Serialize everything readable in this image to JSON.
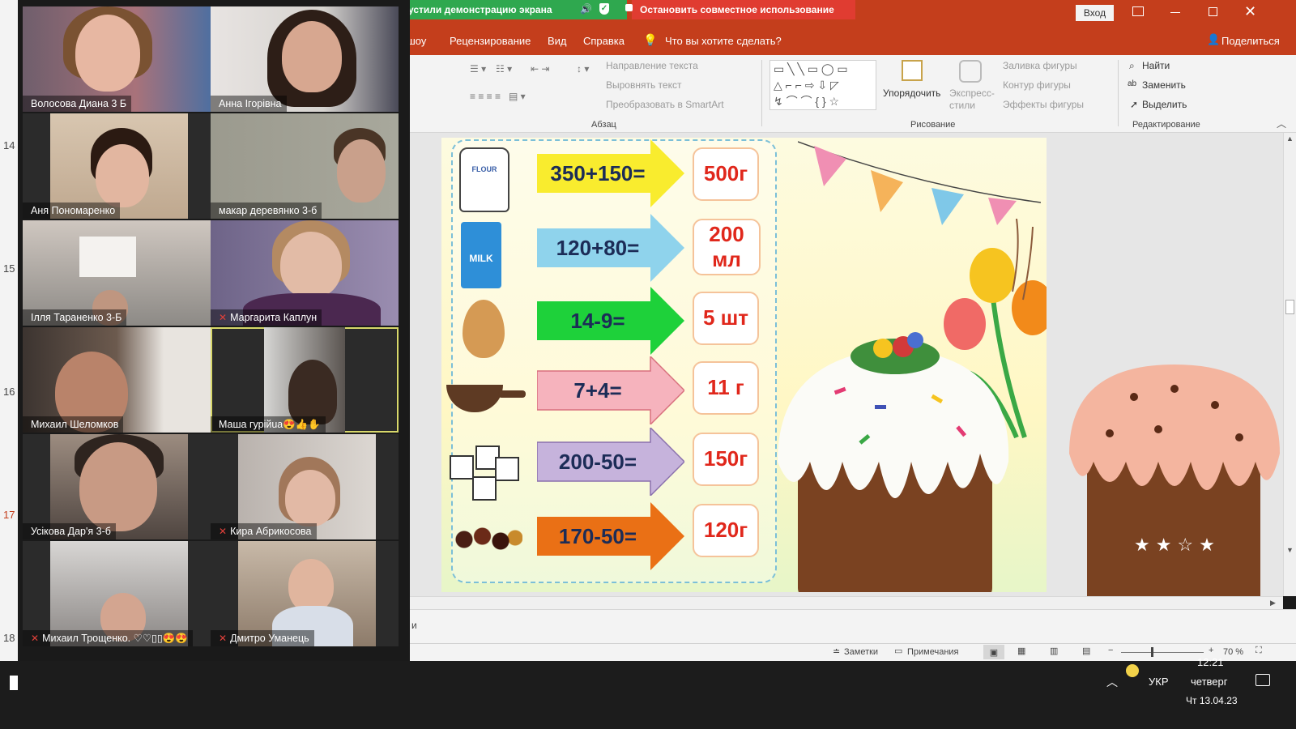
{
  "window": {
    "login_button": "Вход",
    "share_label": "Поделиться"
  },
  "ribbon_tabs": [
    "-шоу",
    "Рецензирование",
    "Вид",
    "Справка",
    "Что вы хотите сделать?"
  ],
  "ribbon": {
    "paragraph": {
      "label": "Абзац",
      "text_direction": "Направление текста",
      "align_text": "Выровнять текст",
      "smartart": "Преобразовать в SmartArt"
    },
    "drawing": {
      "label": "Рисование",
      "arrange": "Упорядочить",
      "quick_styles": "Экспресс-стили",
      "shape_fill": "Заливка фигуры",
      "shape_outline": "Контур фигуры",
      "shape_effects": "Эффекты фигуры"
    },
    "editing": {
      "label": "Редактирование",
      "find": "Найти",
      "replace": "Заменить",
      "select": "Выделить"
    }
  },
  "share_banner": {
    "status": "устили демонстрацию экрана",
    "stop": "Остановить совместное использование"
  },
  "slide": {
    "rows": [
      {
        "equation": "350+150=",
        "answer": "500г",
        "arrow_color": "#f9ec2e",
        "icon": "flour-bag-icon"
      },
      {
        "equation": "120+80=",
        "answer": "200 мл",
        "arrow_color": "#8fd3ec",
        "icon": "milk-carton-icon"
      },
      {
        "equation": "14-9=",
        "answer": "5 шт",
        "arrow_color": "#1ed13a",
        "icon": "egg-icon"
      },
      {
        "equation": "7+4=",
        "answer": "11 г",
        "arrow_color": "#f6b3bd",
        "icon": "scoop-icon"
      },
      {
        "equation": "200-50=",
        "answer": "150г",
        "arrow_color": "#c6b3dc",
        "icon": "sugar-cubes-icon"
      },
      {
        "equation": "170-50=",
        "answer": "120г",
        "arrow_color": "#ea7015",
        "icon": "raisins-icon"
      }
    ]
  },
  "slide_numbers": [
    "14",
    "15",
    "16",
    "17",
    "18"
  ],
  "notes_row": "и",
  "status": {
    "notes": "Заметки",
    "comments": "Примечания",
    "zoom": "70 %"
  },
  "participants": [
    {
      "name": "Волосова Диана 3 Б",
      "muted": false
    },
    {
      "name": "Анна Ігорівна",
      "muted": false
    },
    {
      "name": "Аня Пономаренко",
      "muted": false
    },
    {
      "name": "макар  деревянко 3-б",
      "muted": false
    },
    {
      "name": "Ілля Тараненко 3-Б",
      "muted": false
    },
    {
      "name": "Маргарита Каплун",
      "muted": true
    },
    {
      "name": "Михаил Шеломков",
      "muted": false
    },
    {
      "name": "Маша  гурійuа😍👍✋",
      "muted": false
    },
    {
      "name": "Усікова Дар'я 3-б",
      "muted": false
    },
    {
      "name": "Кира Абрикосова",
      "muted": true
    },
    {
      "name": "Михаил Трощенко. ♡♡▯▯😍😍",
      "muted": true
    },
    {
      "name": "Дмитро Уманець",
      "muted": true
    }
  ],
  "taskbar": {
    "lang": "УКР",
    "time": "12:21",
    "day": "четверг",
    "date": "Чт 13.04.23"
  }
}
